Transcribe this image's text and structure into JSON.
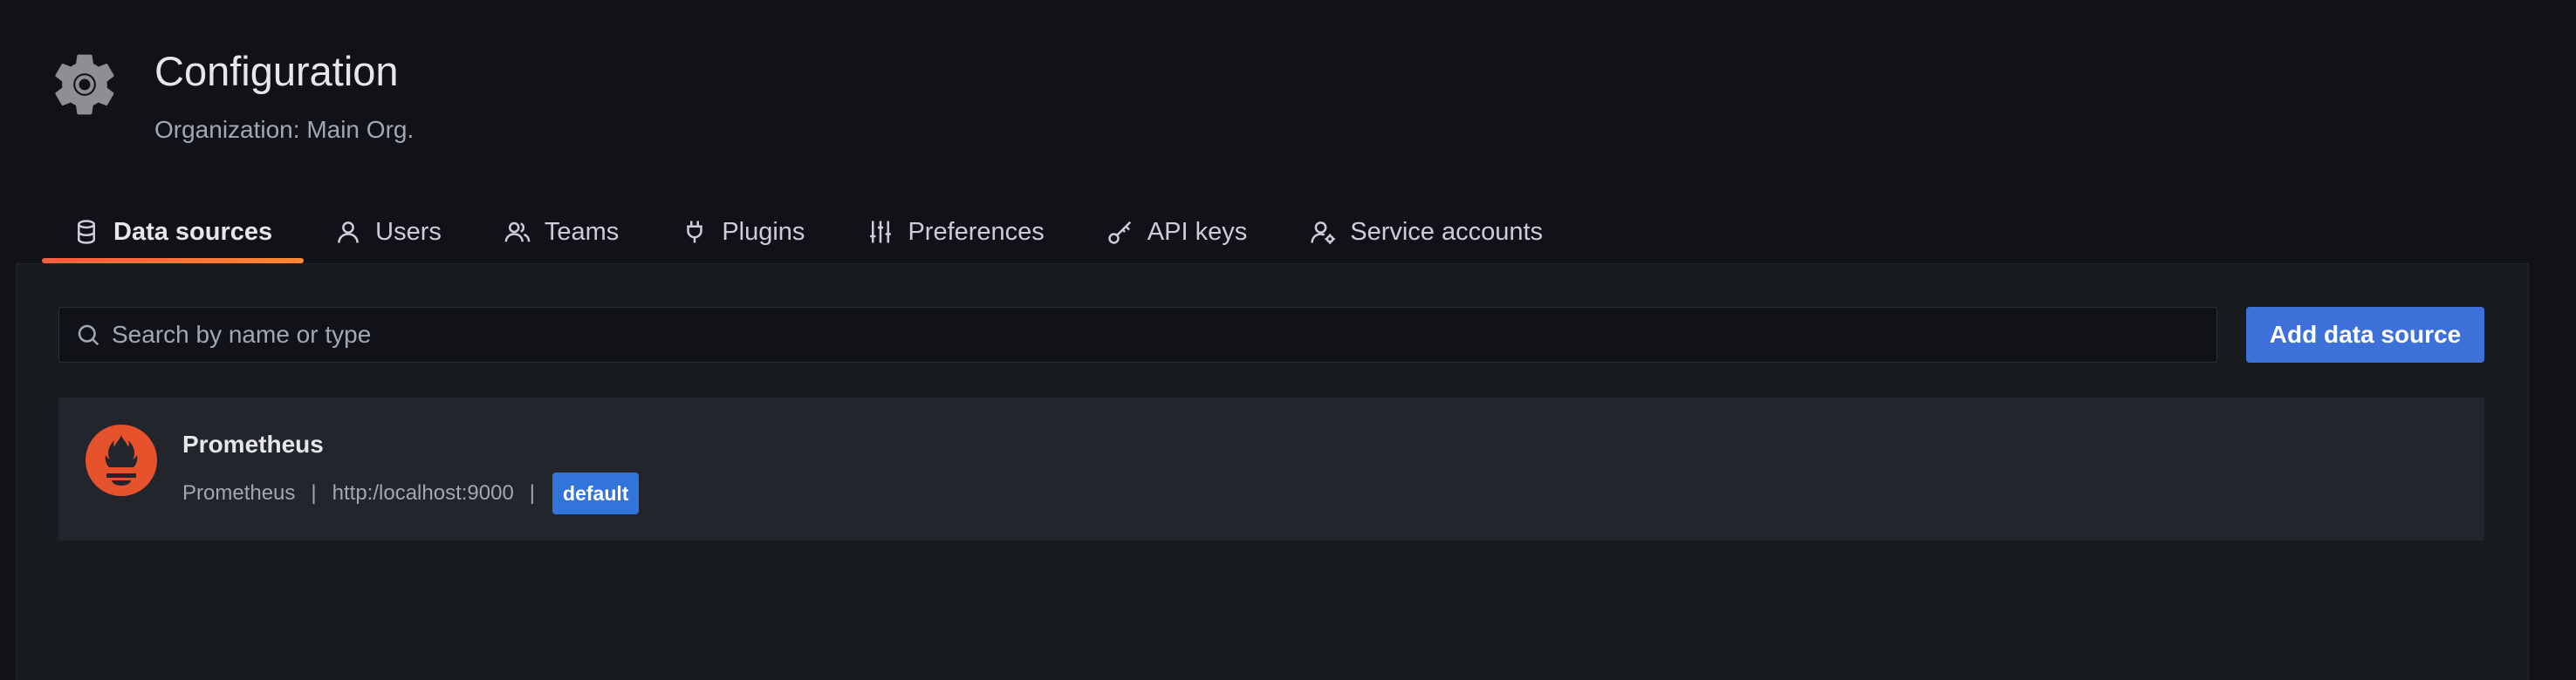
{
  "header": {
    "title": "Configuration",
    "subtitle": "Organization: Main Org.",
    "icon": "gear-icon"
  },
  "tabs": [
    {
      "label": "Data sources",
      "icon": "database-icon",
      "active": true
    },
    {
      "label": "Users",
      "icon": "user-icon",
      "active": false
    },
    {
      "label": "Teams",
      "icon": "users-icon",
      "active": false
    },
    {
      "label": "Plugins",
      "icon": "plug-icon",
      "active": false
    },
    {
      "label": "Preferences",
      "icon": "sliders-icon",
      "active": false
    },
    {
      "label": "API keys",
      "icon": "key-icon",
      "active": false
    },
    {
      "label": "Service accounts",
      "icon": "user-cog-icon",
      "active": false
    }
  ],
  "search": {
    "placeholder": "Search by name or type",
    "value": ""
  },
  "actions": {
    "add_label": "Add data source"
  },
  "datasources": [
    {
      "name": "Prometheus",
      "type": "Prometheus",
      "url": "http:/localhost:9000",
      "separator": "|",
      "badge": "default",
      "icon": "prometheus-logo"
    }
  ],
  "colors": {
    "background": "#111217",
    "panel": "#181b1f",
    "card": "#22252b",
    "accent_tab": "#f55f3e",
    "primary_button": "#3d71d9",
    "badge": "#3274d9",
    "prometheus": "#e6522c"
  }
}
